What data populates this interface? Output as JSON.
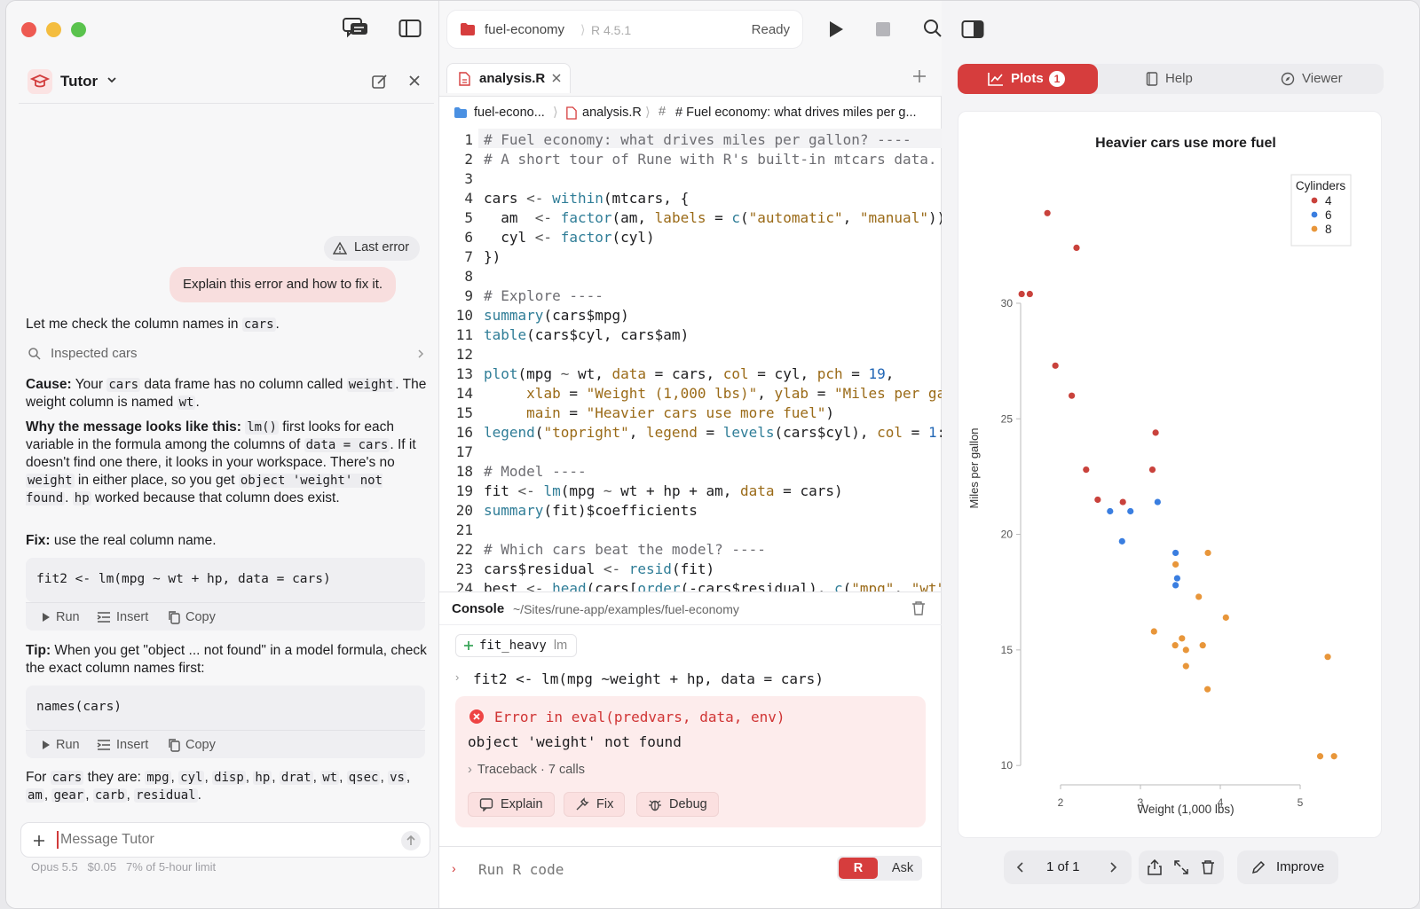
{
  "left": {
    "tutor_title": "Tutor",
    "last_error_chip": "Last error",
    "user_message": "Explain this error and how to fix it.",
    "intro": [
      "Let me check the column names in ",
      "cars",
      "."
    ],
    "inspected": "Inspected cars",
    "cause": {
      "label": "Cause:",
      "t1": " Your ",
      "c1": "cars",
      "t2": " data frame has no column called ",
      "c2": "weight",
      "t3": ". The weight column is named ",
      "c3": "wt",
      "t4": "."
    },
    "why": {
      "label": "Why the message looks like this:",
      "c1": "lm()",
      "t1": " first looks for each variable in the formula among the columns of ",
      "c2": "data = cars",
      "t2": ". If it doesn't find one there, it looks in your workspace. There's no ",
      "c3": "weight",
      "t3": " in either place, so you get ",
      "c4": "object 'weight' not found",
      "t4": ". ",
      "c5": "hp",
      "t5": " worked because that column does exist."
    },
    "fix": {
      "label": "Fix:",
      "text": " use the real column name."
    },
    "code1": "fit2 <- lm(mpg ~ wt + hp, data = cars)",
    "code2": "names(cars)",
    "actions": {
      "run": "Run",
      "insert": "Insert",
      "copy": "Copy"
    },
    "tip": {
      "label": "Tip:",
      "text": " When you get \"object ... not found\" in a model formula, check the exact column names first:"
    },
    "for_cars": {
      "t1": "For ",
      "c1": "cars",
      "t2": " they are: ",
      "cols": [
        "mpg",
        "cyl",
        "disp",
        "hp",
        "drat",
        "wt",
        "qsec",
        "vs",
        "am",
        "gear",
        "carb",
        "residual"
      ]
    },
    "input_placeholder": "Message Tutor",
    "status": "Opus 5.5   $0.05   7% of 5-hour limit"
  },
  "mid": {
    "project": "fuel-economy",
    "r_version": "R 4.5.1",
    "state": "Ready",
    "tab": "analysis.R",
    "crumbs": [
      "fuel-econo...",
      "analysis.R",
      "# Fuel economy: what drives miles per g..."
    ],
    "console_label": "Console",
    "console_path": "~/Sites/rune-app/examples/fuel-economy",
    "env_chip": "fit_heavy",
    "env_chip_type": "lm",
    "command": "fit2 <- lm(mpg ~weight + hp, data = cars)",
    "error_title": "Error in eval(predvars, data, env)",
    "error_msg": "object 'weight' not found",
    "traceback": "Traceback · 7 calls",
    "err_buttons": [
      "Explain",
      "Fix",
      "Debug"
    ],
    "run_placeholder": "Run R code",
    "mode_r": "R",
    "mode_ask": "Ask"
  },
  "right": {
    "tabs": {
      "plots": "Plots",
      "plots_count": "1",
      "help": "Help",
      "viewer": "Viewer"
    },
    "pager": "1 of 1",
    "improve": "Improve"
  },
  "chart_data": {
    "type": "scatter",
    "title": "Heavier cars use more fuel",
    "xlabel": "Weight (1,000 lbs)",
    "ylabel": "Miles per gallon",
    "xlim": [
      1.5,
      5.5
    ],
    "ylim": [
      10,
      35
    ],
    "xticks": [
      "2",
      "3",
      "4",
      "5"
    ],
    "yticks": [
      "10",
      "15",
      "20",
      "25",
      "30"
    ],
    "legend_title": "Cylinders",
    "legend_position": "top-right",
    "series": [
      {
        "name": "4",
        "color": "#c9423c",
        "points": [
          [
            1.835,
            33.9
          ],
          [
            2.2,
            32.4
          ],
          [
            1.615,
            30.4
          ],
          [
            1.513,
            30.4
          ],
          [
            1.935,
            27.3
          ],
          [
            2.14,
            26.0
          ],
          [
            3.19,
            24.4
          ],
          [
            2.32,
            22.8
          ],
          [
            3.15,
            22.8
          ],
          [
            2.465,
            21.5
          ],
          [
            2.78,
            21.4
          ]
        ]
      },
      {
        "name": "6",
        "color": "#3a7ee0",
        "points": [
          [
            2.62,
            21.0
          ],
          [
            2.875,
            21.0
          ],
          [
            3.215,
            21.4
          ],
          [
            2.77,
            19.7
          ],
          [
            3.44,
            19.2
          ],
          [
            3.46,
            18.1
          ],
          [
            3.44,
            17.8
          ]
        ]
      },
      {
        "name": "8",
        "color": "#e8963a",
        "points": [
          [
            3.44,
            18.7
          ],
          [
            3.845,
            19.2
          ],
          [
            3.73,
            17.3
          ],
          [
            4.07,
            16.4
          ],
          [
            3.17,
            15.8
          ],
          [
            3.52,
            15.5
          ],
          [
            3.435,
            15.2
          ],
          [
            3.78,
            15.2
          ],
          [
            3.57,
            15.0
          ],
          [
            3.57,
            14.3
          ],
          [
            3.84,
            13.3
          ],
          [
            5.345,
            14.7
          ],
          [
            5.25,
            10.4
          ],
          [
            5.424,
            10.4
          ]
        ]
      }
    ]
  }
}
